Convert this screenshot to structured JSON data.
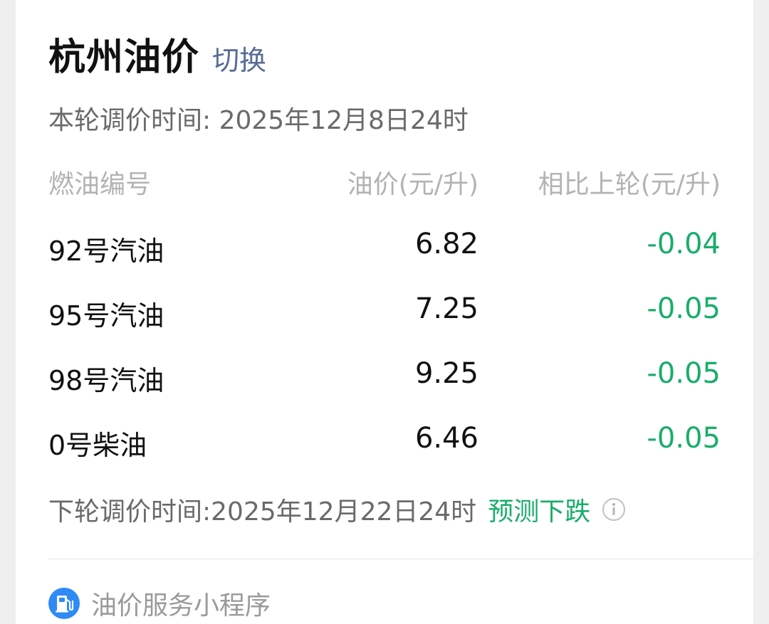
{
  "header": {
    "title": "杭州油价",
    "switch_label": "切换"
  },
  "current_adjust": {
    "label": "本轮调价时间: ",
    "time": "2025年12月8日24时"
  },
  "table": {
    "headers": {
      "name": "燃油编号",
      "price": "油价(元/升)",
      "change": "相比上轮(元/升)"
    },
    "rows": [
      {
        "name": "92号汽油",
        "price": "6.82",
        "change": "-0.04"
      },
      {
        "name": "95号汽油",
        "price": "7.25",
        "change": "-0.05"
      },
      {
        "name": "98号汽油",
        "price": "9.25",
        "change": "-0.05"
      },
      {
        "name": "0号柴油",
        "price": "6.46",
        "change": "-0.05"
      }
    ]
  },
  "next_adjust": {
    "label": "下轮调价时间: ",
    "time": "2025年12月22日24时",
    "forecast": "预测下跌",
    "info_icon": "info-icon"
  },
  "footer": {
    "label": "油价服务小程序",
    "icon": "fuel-pump-icon"
  },
  "colors": {
    "link": "#576b95",
    "decrease": "#1aad6a",
    "icon_blue": "#2f8af5"
  }
}
